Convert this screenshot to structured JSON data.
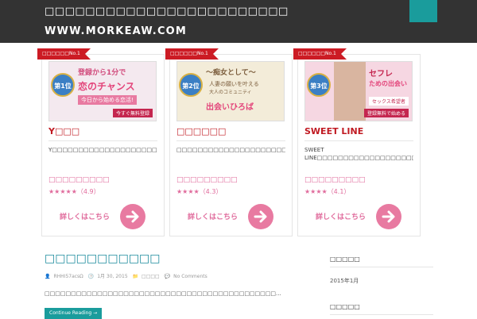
{
  "header": {
    "site_title": "□□□□□□□□□□□□□□□□□□□□□□□□",
    "site_url": "WWW.MORKEAW.COM"
  },
  "cards": [
    {
      "ribbon": "□□□□□□No.1",
      "banner": {
        "rank": "第1位",
        "line1": "登録から1分で",
        "line2": "恋のチャンス",
        "line3": "今日から始める恋活!",
        "line4": "今すぐ無料登録"
      },
      "title": "Y□□□",
      "desc": "Y□□□□□□□□□□□□□□□□□□□□□□□□□□□□□□□□□□□□□□□□□□□□□□□□□□□□□□□□□□□□□□□□□□□□□",
      "link": "□□□□□□□□□",
      "rating": "★★★★★（4.9）",
      "more": "詳しくはこちら"
    },
    {
      "ribbon": "□□□□□□No.1",
      "banner": {
        "rank": "第2位",
        "line1": "～痴女として～",
        "line2": "出会いひろば",
        "line3": "人妻の願いを叶える",
        "line4": "大人のコミュニティ"
      },
      "title": "□□□□□□",
      "desc": "□□□□□□□□□□□□□□□□□□□□□□□□□□□□□□□□□□□□□□□□□□□□□□□□□□□□□□□□□□□□",
      "link": "□□□□□□□□□",
      "rating": "★★★★（4.3）",
      "more": "詳しくはこちら"
    },
    {
      "ribbon": "□□□□□□No.1",
      "banner": {
        "rank": "第3位",
        "line1": "セフレ",
        "line2": "ための出会い",
        "line3": "セックス希望者",
        "line4": "登録無料で始める"
      },
      "title": "SWEET LINE",
      "desc": "SWEET LINE□□□□□□□□□□□□□□□□□□□□□□□□□□□□□□□□□□□□□□□□□□□□□□□□□□□□",
      "link": "□□□□□□□□□",
      "rating": "★★★★（4.1）",
      "more": "詳しくはこちら"
    }
  ],
  "post": {
    "title": "□□□□□□□□□□□",
    "author": "RHHI57acsΩ",
    "date": "1月 30, 2015",
    "category": "□□□□",
    "comments": "No Comments",
    "excerpt": "□□□□□□□□□□□□□□□□□□□□□□□□□□□□□□□□□□□□□□□□□□□□...",
    "continue_label": "Continue Reading →"
  },
  "sidebar": {
    "widget1_title": "□□□□□",
    "archive_item": "2015年1月",
    "widget2_title": "□□□□□"
  },
  "colors": {
    "header_bg": "#333333",
    "accent_teal": "#1a9c9c",
    "ribbon_red": "#cc1b24",
    "pink": "#e06b9c"
  }
}
